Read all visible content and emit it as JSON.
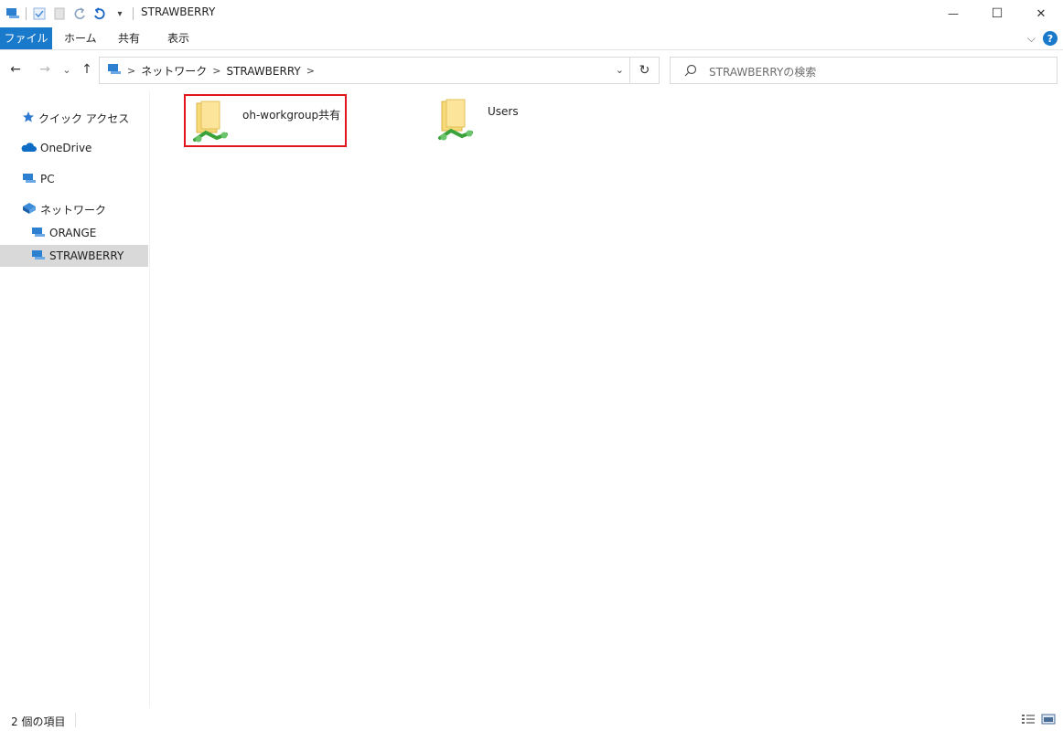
{
  "window": {
    "title": "STRAWBERRY",
    "qat_dropdown": "▾",
    "minimize": "—",
    "maximize": "☐",
    "close": "✕"
  },
  "ribbon": {
    "tabs": [
      "ファイル",
      "ホーム",
      "共有",
      "表示"
    ],
    "expand": "⌵",
    "help": "?"
  },
  "nav": {
    "back": "←",
    "forward": "→",
    "recent": "⌄",
    "up": "↑"
  },
  "address": {
    "crumbs": [
      "ネットワーク",
      "STRAWBERRY"
    ],
    "separator": ">",
    "dropdown": "⌄",
    "refresh": "↻"
  },
  "search": {
    "placeholder": "STRAWBERRYの検索"
  },
  "sidebar": {
    "items": [
      {
        "label": "クイック アクセス",
        "icon": "star-icon"
      },
      {
        "label": "OneDrive",
        "icon": "cloud-icon"
      },
      {
        "label": "PC",
        "icon": "computer-icon"
      },
      {
        "label": "ネットワーク",
        "icon": "network-icon"
      },
      {
        "label": "ORANGE",
        "icon": "computer-icon"
      },
      {
        "label": "STRAWBERRY",
        "icon": "computer-icon"
      }
    ]
  },
  "content": {
    "items": [
      {
        "label": "oh-workgroup共有",
        "icon": "shared-folder-icon",
        "highlighted": true
      },
      {
        "label": "Users",
        "icon": "shared-folder-icon",
        "highlighted": false
      }
    ]
  },
  "status": {
    "count": "2 個の項目"
  },
  "colors": {
    "accent": "#1979ca",
    "highlight": "#e3141b",
    "selection": "#d9d9d9"
  }
}
